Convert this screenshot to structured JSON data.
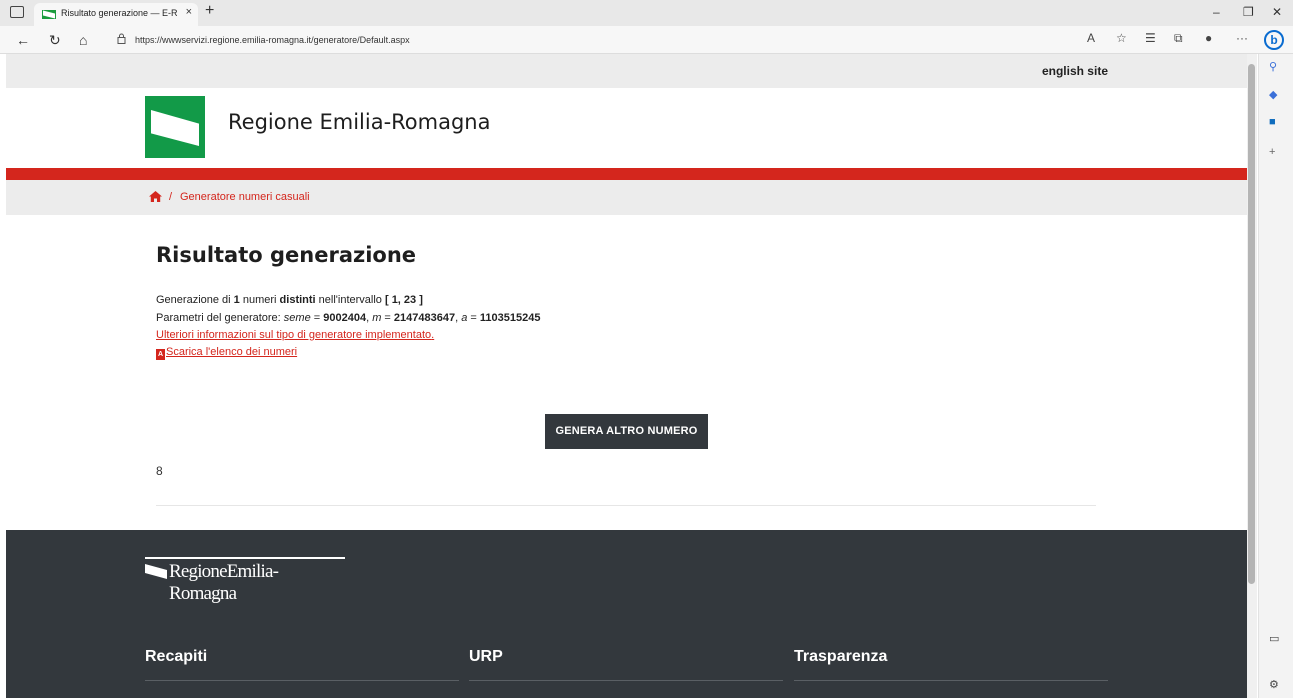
{
  "browser": {
    "tab_title": "Risultato generazione — E-R Il portale",
    "tab_close": "×",
    "new_tab": "+",
    "url": "https://wwwservizi.regione.emilia-romagna.it/generatore/Default.aspx",
    "win_minimize": "–",
    "win_restore": "❐",
    "win_close": "✕",
    "more": "···",
    "bing": "b"
  },
  "header": {
    "english_site": "english site",
    "site_name": "Regione Emilia-Romagna"
  },
  "breadcrumb": {
    "separator": "/",
    "current": "Generatore numeri casuali"
  },
  "main": {
    "title": "Risultato generazione",
    "line1": {
      "a": "Generazione di ",
      "count": "1",
      "b": " numeri ",
      "distinct": "distinti",
      "c": " nell'intervallo ",
      "interval": "[ 1, 23 ]"
    },
    "line2": {
      "a": "Parametri del generatore: ",
      "seed_label": "seme",
      "eq1": " = ",
      "seed": "9002404",
      "sep1": ", ",
      "m_label": "m",
      "eq2": " = ",
      "m": "2147483647",
      "sep2": ", ",
      "a_label": "a",
      "eq3": " = ",
      "a_val": "1103515245"
    },
    "info_link": "Ulteriori informazioni sul tipo di generatore implementato",
    "info_link_suffix": ".",
    "download_link": "Scarica l'elenco dei numeri",
    "generate_button": "GENERA ALTRO NUMERO",
    "result": "8"
  },
  "footer": {
    "logo_text": "RegioneEmilia-Romagna",
    "col1": "Recapiti",
    "col2": "URP",
    "col3": "Trasparenza"
  },
  "colors": {
    "accent_red": "#d4261d",
    "brand_green": "#129a48",
    "footer_bg": "#33383d"
  }
}
